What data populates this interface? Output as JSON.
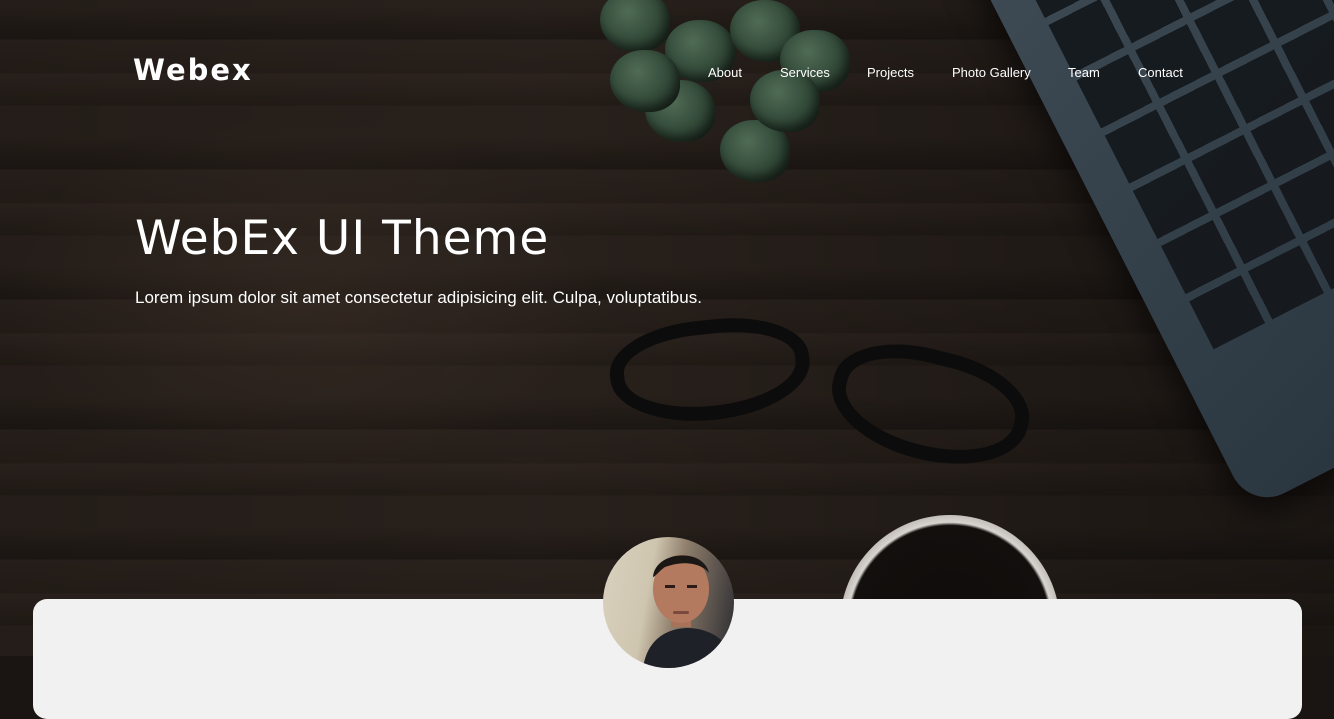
{
  "brand": {
    "name": "Webex"
  },
  "nav": {
    "items": [
      {
        "label": "About"
      },
      {
        "label": "Services"
      },
      {
        "label": "Projects"
      },
      {
        "label": "Photo Gallery"
      },
      {
        "label": "Team"
      },
      {
        "label": "Contact"
      }
    ]
  },
  "hero": {
    "title": "WebEx UI Theme",
    "subtitle": "Lorem ipsum dolor sit amet consectetur adipisicing elit. Culpa, voluptatibus."
  },
  "colors": {
    "text": "#ffffff",
    "card_bg": "#f1f1f1",
    "hero_bg": "#261f1a"
  }
}
